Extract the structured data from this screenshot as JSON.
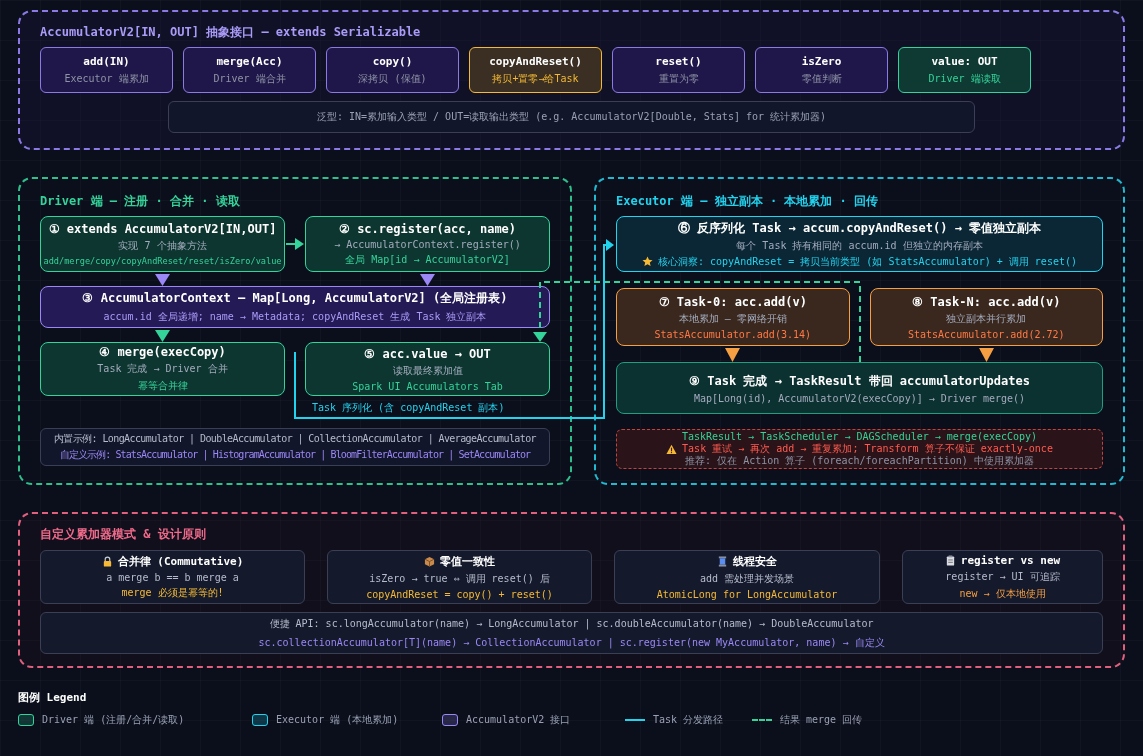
{
  "interface": {
    "title": "AccumulatorV2[IN, OUT] 抽象接口 — extends Serializable",
    "methods": [
      {
        "name": "add(IN)",
        "desc": "Executor 端累加",
        "kind": "normal"
      },
      {
        "name": "merge(Acc)",
        "desc": "Driver 端合并",
        "kind": "normal"
      },
      {
        "name": "copy()",
        "desc": "深拷贝 (保值)",
        "kind": "normal"
      },
      {
        "name": "copyAndReset()",
        "desc": "拷贝+置零→给Task",
        "kind": "highlight"
      },
      {
        "name": "reset()",
        "desc": "重置为零",
        "kind": "normal"
      },
      {
        "name": "isZero",
        "desc": "零值判断",
        "kind": "normal"
      },
      {
        "name": "value: OUT",
        "desc": "Driver 端读取",
        "kind": "output"
      }
    ],
    "note": "泛型: IN=累加输入类型 / OUT=读取输出类型 (e.g. AccumulatorV2[Double, Stats] for 统计累加器)"
  },
  "driver": {
    "title": "Driver 端 — 注册 · 合并 · 读取",
    "steps": [
      {
        "title": "① extends AccumulatorV2[IN,OUT]",
        "desc": "实现 7 个抽象方法",
        "detail": "add/merge/copy/copyAndReset/reset/isZero/value",
        "kind": "driver"
      },
      {
        "title": "② sc.register(acc, name)",
        "desc": "→ AccumulatorContext.register()",
        "detail": "全局 Map[id → AccumulatorV2]",
        "kind": "driver"
      },
      {
        "title": "③ AccumulatorContext — Map[Long, AccumulatorV2] (全局注册表)",
        "desc": "accum.id 全局递增; name → Metadata; copyAndReset 生成 Task 独立副本",
        "kind": "context"
      },
      {
        "title": "④ merge(execCopy)",
        "desc": "Task 完成 → Driver 合并",
        "detail": "幂等合并律",
        "kind": "driver"
      },
      {
        "title": "⑤ acc.value → OUT",
        "desc": "读取最终累加值",
        "detail": "Spark UI Accumulators Tab",
        "kind": "driver"
      }
    ],
    "examples": {
      "builtin": "内置示例: LongAccumulator | DoubleAccumulator | CollectionAccumulator | AverageAccumulator",
      "custom": "自定义示例: StatsAccumulator | HistogramAccumulator | BloomFilterAccumulator | SetAccumulator"
    }
  },
  "executor": {
    "title": "Executor 端 — 独立副本 · 本地累加 · 回传",
    "steps": [
      {
        "title": "⑥ 反序列化 Task → accum.copyAndReset() → 零值独立副本",
        "desc": "每个 Task 持有相同的 accum.id 但独立的内存副本",
        "detail": "核心洞察: copyAndReset = 拷贝当前类型 (如 StatsAccumulator) + 调用 reset()",
        "kind": "executor"
      },
      {
        "title": "⑦ Task-0: acc.add(v)",
        "desc": "本地累加 — 零网络开销",
        "detail": "StatsAccumulator.add(3.14)",
        "kind": "task"
      },
      {
        "title": "⑧ Task-N: acc.add(v)",
        "desc": "独立副本并行累加",
        "detail": "StatsAccumulator.add(2.72)",
        "kind": "task"
      },
      {
        "title": "⑨ Task 完成 → TaskResult 带回 accumulatorUpdates",
        "desc": "Map[Long(id), AccumulatorV2(execCopy)] → Driver merge()",
        "kind": "result"
      }
    ],
    "warning": {
      "path": "TaskResult → TaskScheduler → DAGScheduler → merge(execCopy)",
      "text": "Task 重试 → 再次 add → 重复累加; Transform 算子不保证 exactly-once",
      "advice": "推荐: 仅在 Action 算子 (foreach/foreachPartition) 中使用累加器"
    }
  },
  "connectors": {
    "dispatch_label": "Task 序列化 (含 copyAndReset 副本)"
  },
  "patterns": {
    "title": "自定义累加器模式 & 设计原则",
    "principles": [
      {
        "title": "合并律 (Commutative)",
        "desc": "a merge b == b merge a",
        "note": "merge 必须是幂等的!"
      },
      {
        "title": "零值一致性",
        "desc": "isZero → true ⇔ 调用 reset() 后",
        "note": "copyAndReset = copy() + reset()"
      },
      {
        "title": "线程安全",
        "desc": "add 需处理并发场景",
        "note": "AtomicLong for LongAccumulator"
      },
      {
        "title": "register vs new",
        "desc": "register → UI 可追踪",
        "note": "new → 仅本地使用"
      }
    ],
    "api": [
      "便捷 API: sc.longAccumulator(name) → LongAccumulator | sc.doubleAccumulator(name) → DoubleAccumulator",
      "sc.collectionAccumulator[T](name) → CollectionAccumulator | sc.register(new MyAccumulator, name) → 自定义"
    ]
  },
  "legend": {
    "title": "图例 Legend",
    "items": [
      {
        "label": "Driver 端 (注册/合并/读取)",
        "kind": "swatch",
        "color": "#34d399"
      },
      {
        "label": "Executor 端 (本地累加)",
        "kind": "swatch",
        "color": "#22d3ee"
      },
      {
        "label": "AccumulatorV2 接口",
        "kind": "swatch",
        "color": "#9b87f5"
      },
      {
        "label": "Task 分发路径",
        "kind": "line",
        "color": "#22d3ee"
      },
      {
        "label": "结果 merge 回传",
        "kind": "dashed",
        "color": "#34d399"
      }
    ]
  }
}
